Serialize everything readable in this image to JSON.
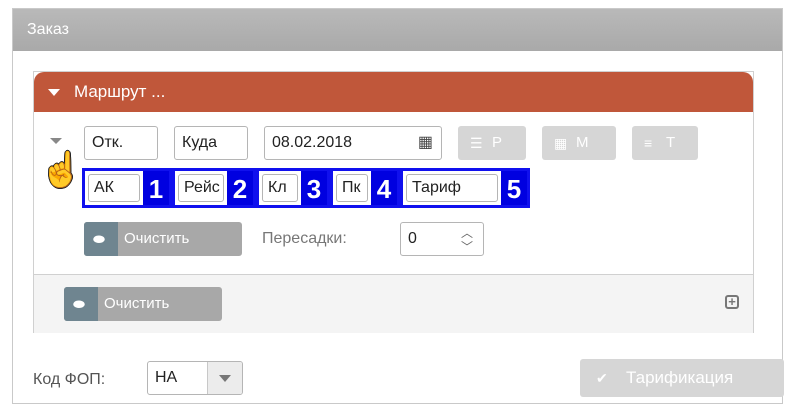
{
  "order": {
    "title": "Заказ"
  },
  "route": {
    "title": "Маршрут ...",
    "from_value": "Отк.",
    "to_value": "Куда",
    "date_value": "08.02.2018",
    "buttons": [
      {
        "icon": "list-icon",
        "label": "Р"
      },
      {
        "icon": "grid-icon",
        "label": "М"
      },
      {
        "icon": "tariff-icon",
        "label": "Т"
      }
    ],
    "highlighted_fields": [
      {
        "value": "АК",
        "number": "1"
      },
      {
        "value": "Рейс",
        "number": "2"
      },
      {
        "value": "Кл",
        "number": "3"
      },
      {
        "value": "Пк",
        "number": "4"
      },
      {
        "value": "Тариф",
        "number": "5"
      }
    ],
    "clear_label": "Очистить",
    "transfers_label": "Пересадки:",
    "transfers_value": "0"
  },
  "footer": {
    "clear_label": "Очистить"
  },
  "bottom": {
    "fop_label": "Код ФОП:",
    "fop_value": "НА",
    "tariff_button_label": "Тарификация"
  },
  "colors": {
    "route_header": "#c0573a",
    "highlight": "#0000e0",
    "header_gray": "#b0b0b0"
  }
}
